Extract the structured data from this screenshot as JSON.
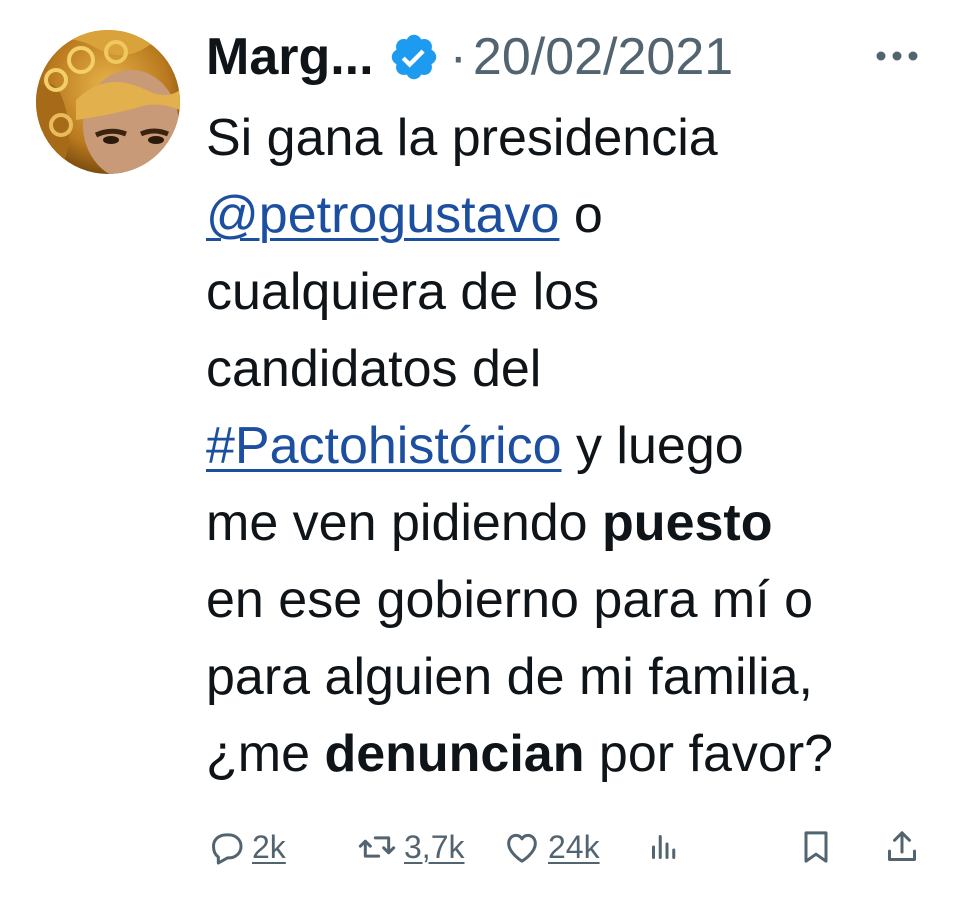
{
  "tweet": {
    "author_name": "Marg...",
    "separator": "·",
    "date": "20/02/2021",
    "avatar_icon": "user-avatar-photo",
    "verified_icon": "verified-badge-icon",
    "more_icon": "more-options-icon",
    "text": {
      "l1": "Si gana la presidencia",
      "mention": "@petrogustavo",
      "l2_rest": " o",
      "l3": "cualquiera de los",
      "l4": "candidatos del",
      "hashtag": "#Pactohistórico",
      "l5_rest": " y luego",
      "l6_a": "me ven pidiendo ",
      "l6_bold": "puesto",
      "l7": "en ese gobierno para mí o",
      "l8": "para alguien de mi familia,",
      "l9_a": "¿me ",
      "l9_bold": "denuncian",
      "l9_b": " por favor?"
    }
  },
  "actions": {
    "replies": "2k",
    "retweets": "3,7k",
    "likes": "24k",
    "icons": [
      "reply-icon",
      "retweet-icon",
      "like-icon",
      "views-icon",
      "bookmark-icon",
      "share-icon"
    ]
  },
  "colors": {
    "text": "#0f1419",
    "secondary": "#536471",
    "link": "#1d4fa0",
    "verified": "#1d9bf0"
  }
}
